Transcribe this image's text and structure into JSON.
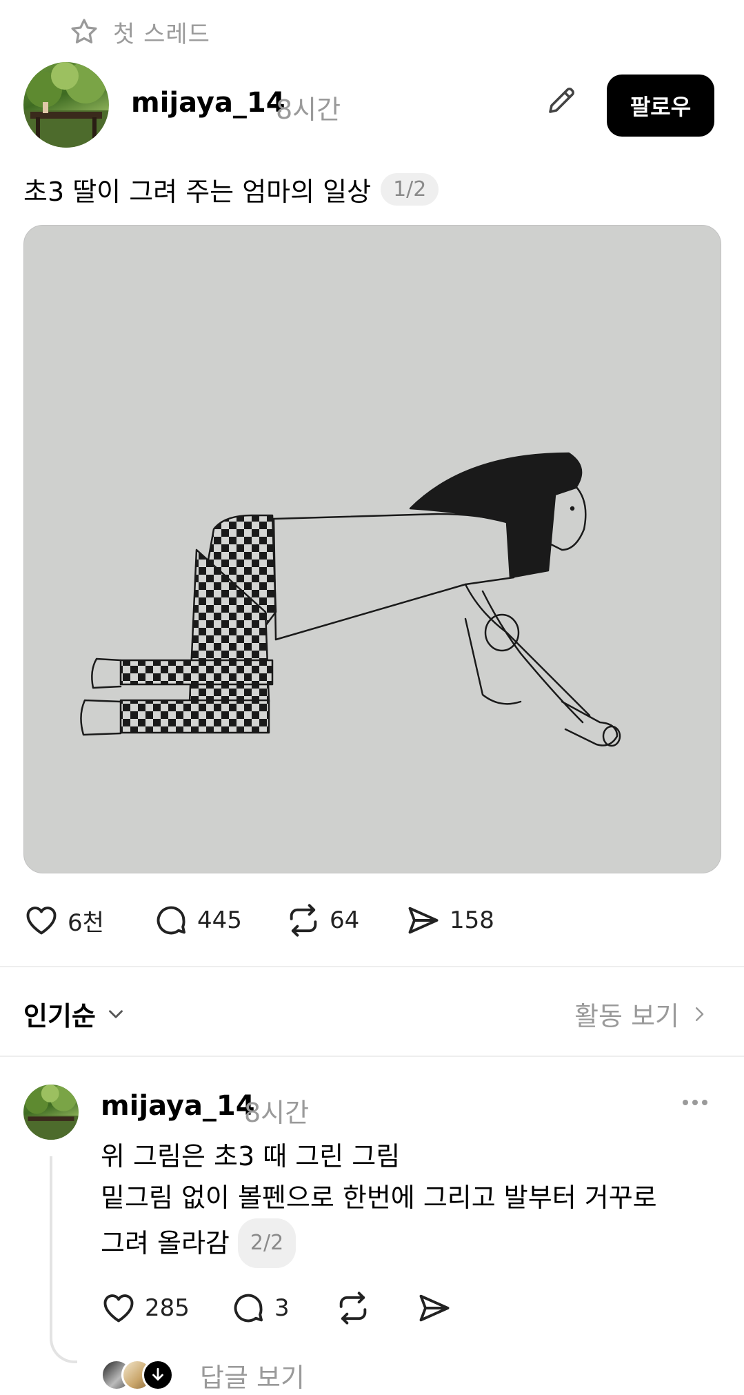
{
  "thread_label": "첫 스레드",
  "post": {
    "username": "mijaya_14",
    "time": "8시간",
    "follow_label": "팔로우",
    "caption": "초3 딸이 그려 주는 엄마의 일상",
    "image_counter": "1/2",
    "likes": "6천",
    "comments": "445",
    "reposts": "64",
    "shares": "158"
  },
  "sort": {
    "label": "인기순",
    "activity_label": "활동 보기"
  },
  "reply": {
    "username": "mijaya_14",
    "time": "8시간",
    "lines": [
      "위 그림은 초3 때 그린 그림",
      "밑그림 없이 볼펜으로 한번에 그리고 발부터 거꾸로",
      "그려 올라감"
    ],
    "counter": "2/2",
    "likes": "285",
    "comments": "3",
    "see_replies_label": "답글 보기"
  }
}
